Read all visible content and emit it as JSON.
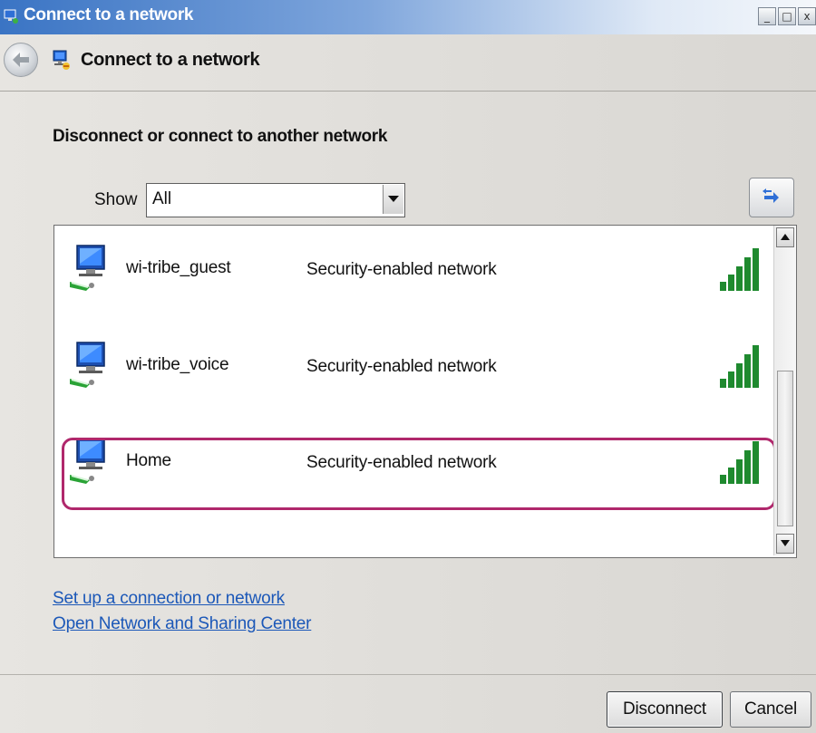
{
  "window": {
    "title": "Connect to a network",
    "controls": {
      "minimize": "_",
      "maximize": "□",
      "close": "x"
    }
  },
  "nav": {
    "title": "Connect to a network",
    "back_icon": "back-arrow-icon"
  },
  "heading": "Disconnect or connect to another network",
  "filter": {
    "label": "Show",
    "selected": "All"
  },
  "networks": [
    {
      "name": "wi-tribe_guest",
      "security": "Security-enabled network",
      "signal_bars": 5,
      "selected": false
    },
    {
      "name": "wi-tribe_voice",
      "security": "Security-enabled network",
      "signal_bars": 5,
      "selected": false
    },
    {
      "name": "Home",
      "security": "Security-enabled network",
      "signal_bars": 5,
      "selected": true
    }
  ],
  "links": {
    "setup": "Set up a connection or network",
    "sharing_center": "Open Network and Sharing Center"
  },
  "buttons": {
    "disconnect": "Disconnect",
    "cancel": "Cancel"
  },
  "colors": {
    "highlight": "#b0286c",
    "signal": "#1f8a2f",
    "link": "#1c58b8",
    "title_gradient_start": "#3a74c4"
  }
}
